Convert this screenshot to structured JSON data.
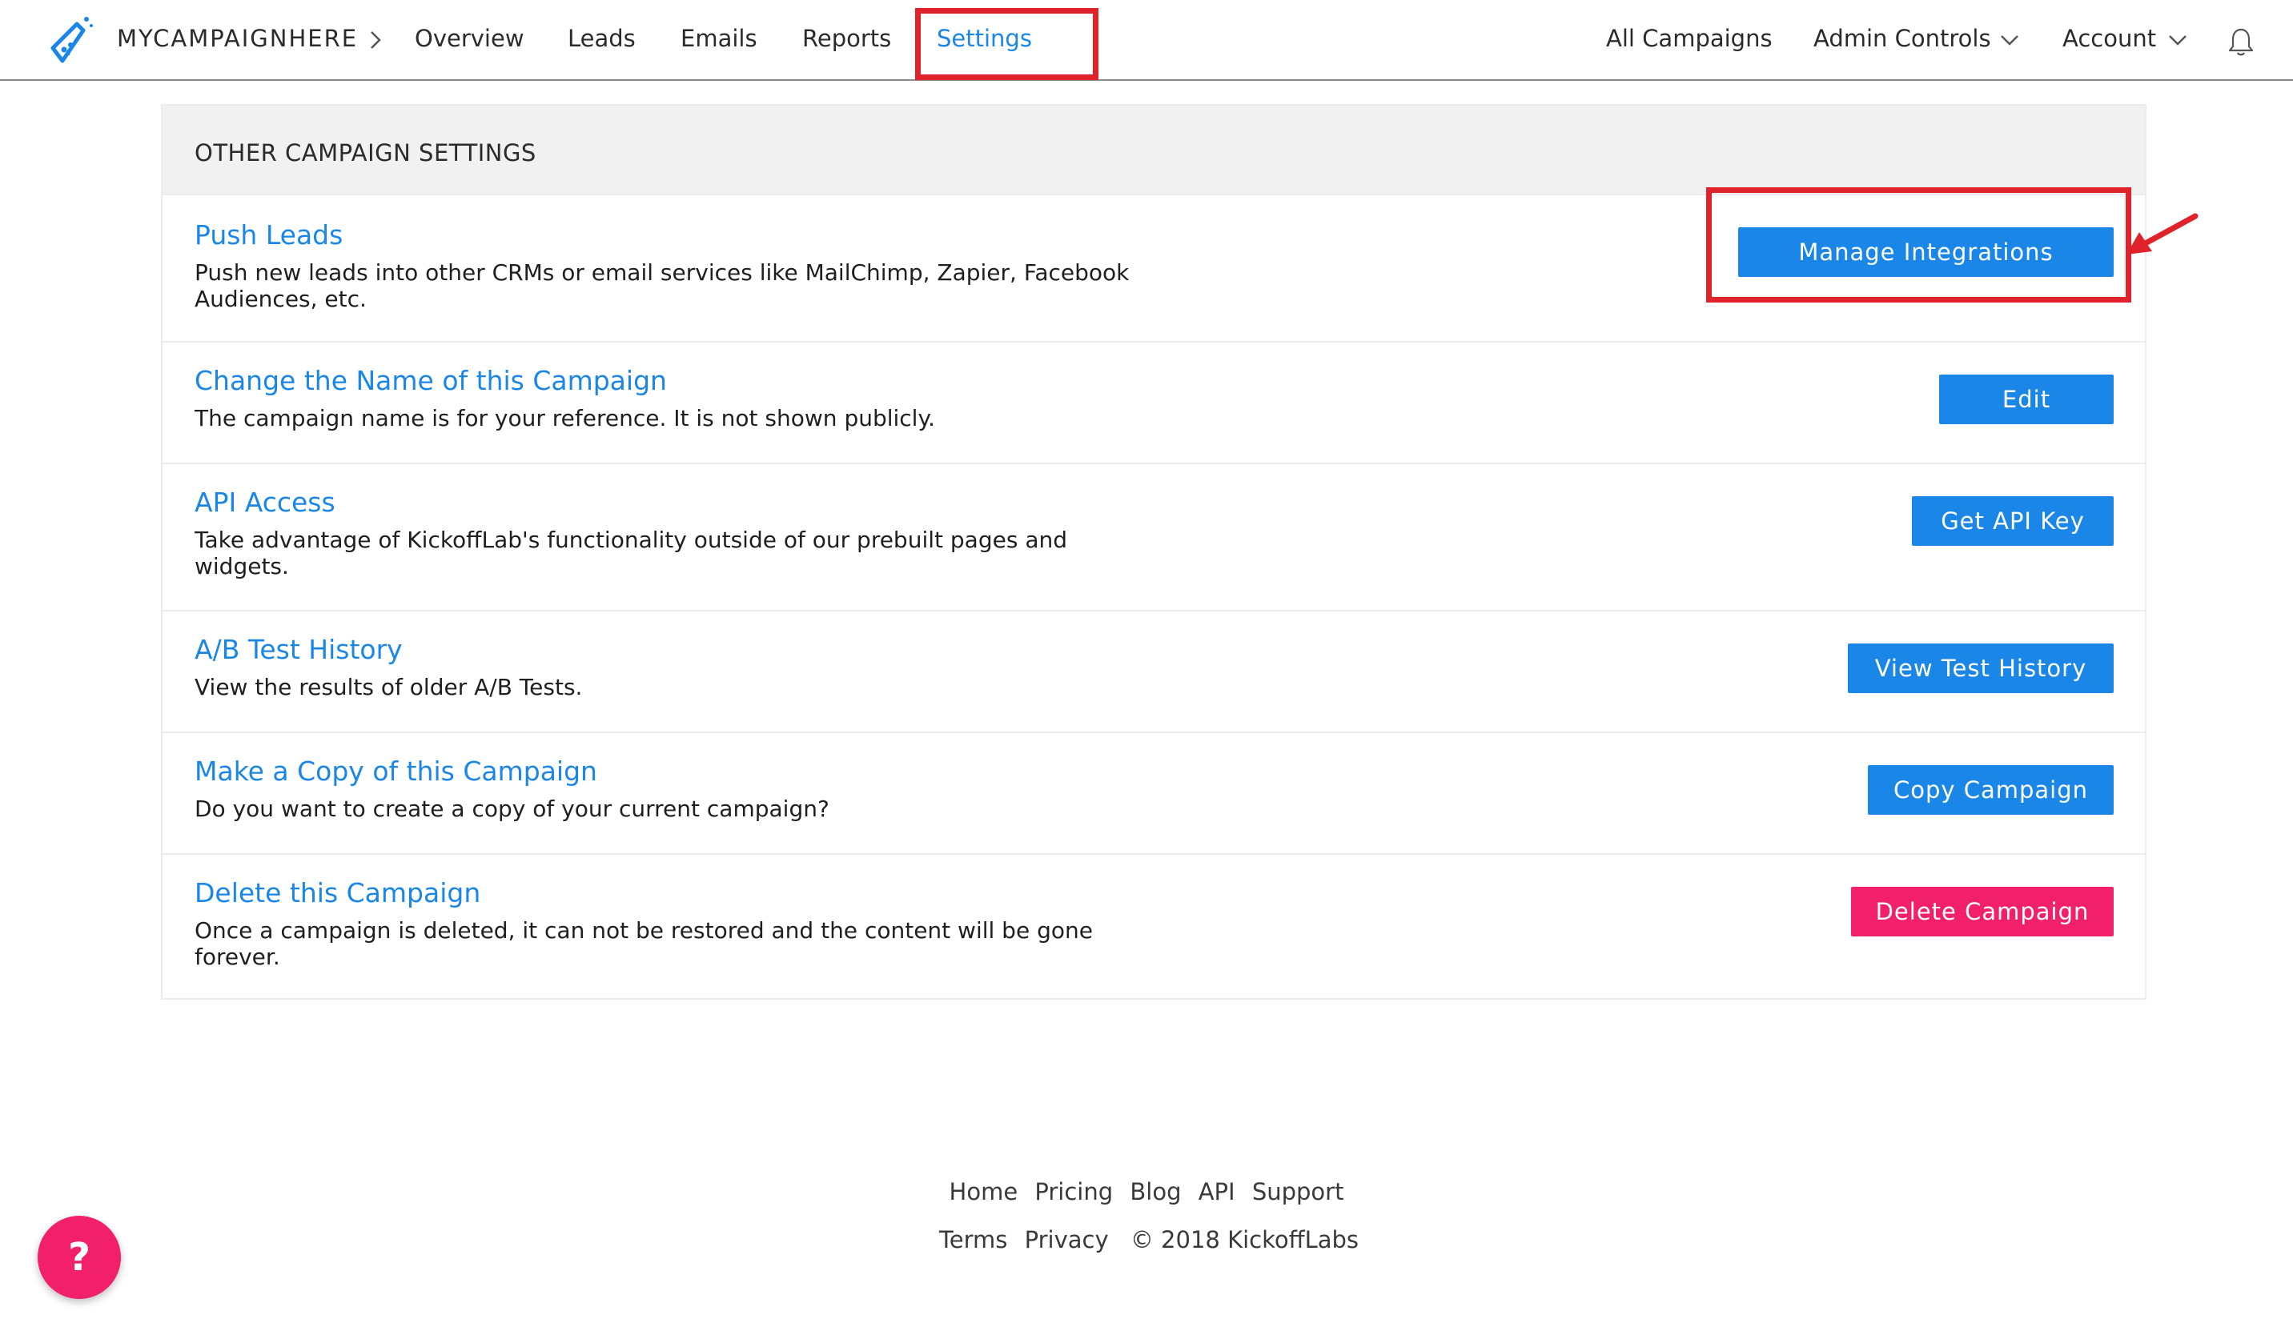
{
  "nav": {
    "brand": "MYCAMPAIGNHERE",
    "links": [
      "Overview",
      "Leads",
      "Emails",
      "Reports",
      "Settings"
    ],
    "active": "Settings",
    "right_links": [
      "All Campaigns",
      "Admin Controls",
      "Account"
    ]
  },
  "panel": {
    "title": "OTHER CAMPAIGN SETTINGS",
    "rows": [
      {
        "title": "Push Leads",
        "desc": "Push new leads into other CRMs or email services like MailChimp, Zapier, Facebook Audiences, etc.",
        "button": "Manage Integrations"
      },
      {
        "title": "Change the Name of this Campaign",
        "desc": "The campaign name is for your reference. It is not shown publicly.",
        "button": "Edit"
      },
      {
        "title": "API Access",
        "desc": "Take advantage of KickoffLab's functionality outside of our prebuilt pages and widgets.",
        "button": "Get API Key"
      },
      {
        "title": "A/B Test History",
        "desc": "View the results of older A/B Tests.",
        "button": "View Test History"
      },
      {
        "title": "Make a Copy of this Campaign",
        "desc": "Do you want to create a copy of your current campaign?",
        "button": "Copy Campaign"
      },
      {
        "title": "Delete this Campaign",
        "desc": "Once a campaign is deleted, it can not be restored and the content will be gone forever.",
        "button": "Delete Campaign"
      }
    ]
  },
  "footer": {
    "links_row1": [
      "Home",
      "Pricing",
      "Blog",
      "API",
      "Support"
    ],
    "links_row2": [
      "Terms",
      "Privacy"
    ],
    "copyright": "© 2018 KickoffLabs"
  },
  "help": {
    "label": "?"
  },
  "colors": {
    "accent": "#1a86e8",
    "danger": "#f21f6a",
    "annotation": "#e0232b"
  },
  "icons": {
    "logo": "flask-logo-icon",
    "breadcrumb": "chevron-right-icon",
    "dropdown": "chevron-down-icon",
    "notifications": "bell-icon"
  }
}
